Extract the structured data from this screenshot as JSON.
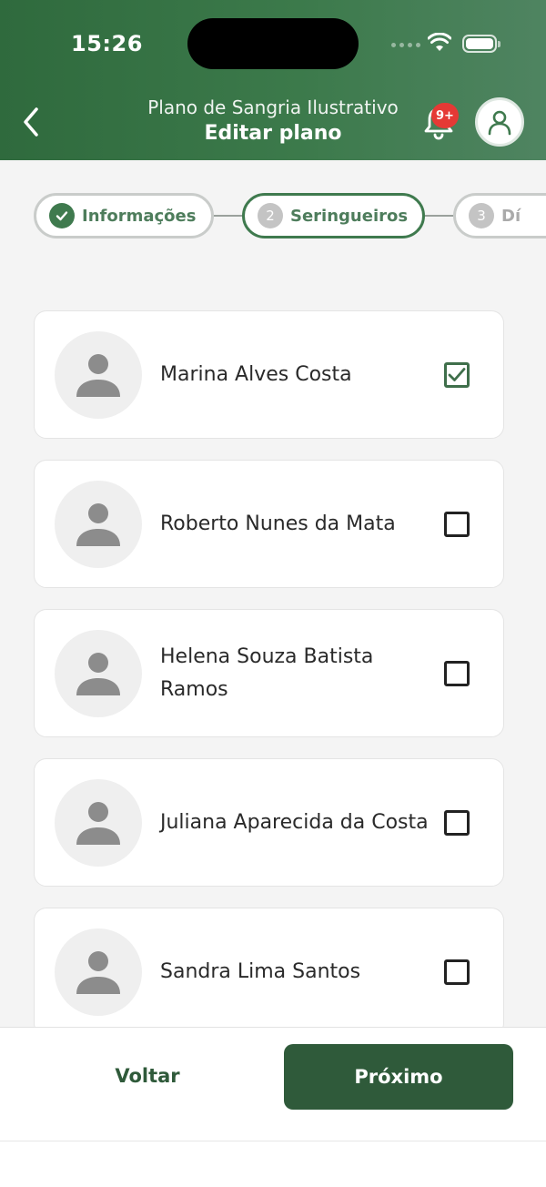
{
  "status_bar": {
    "time": "15:26"
  },
  "header": {
    "subtitle": "Plano de Sangria Ilustrativo",
    "title": "Editar plano",
    "notification_badge": "9+",
    "colors": {
      "header_green": "#3c7a4b",
      "badge_red": "#e53935"
    },
    "icons": [
      "back-arrow-icon",
      "bell-icon",
      "user-icon"
    ]
  },
  "stepper": {
    "steps": [
      {
        "number": "1",
        "label": "Informações",
        "state": "done"
      },
      {
        "number": "2",
        "label": "Seringueiros",
        "state": "active"
      },
      {
        "number": "3",
        "label": "Dí",
        "state": "pending"
      }
    ]
  },
  "seringueiros": [
    {
      "name": "Marina Alves Costa",
      "selected": true
    },
    {
      "name": "Roberto Nunes da Mata",
      "selected": false
    },
    {
      "name": "Helena Souza Batista Ramos",
      "selected": false
    },
    {
      "name": "Juliana Aparecida da Costa",
      "selected": false
    },
    {
      "name": "Sandra Lima Santos",
      "selected": false
    }
  ],
  "footer": {
    "back_label": "Voltar",
    "next_label": "Próximo",
    "colors": {
      "primary": "#2f5a3a"
    }
  }
}
